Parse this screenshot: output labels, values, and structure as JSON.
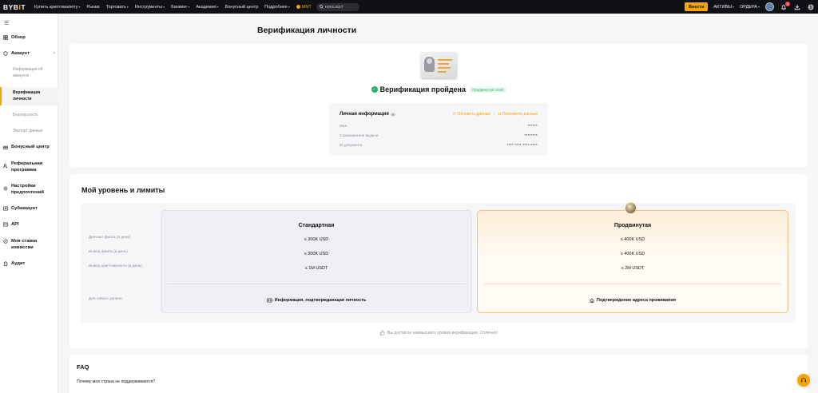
{
  "topbar": {
    "logo_main": "BYB",
    "logo_accent": "I",
    "logo_end": "T",
    "nav": [
      {
        "label": "Купить криптовалюту",
        "has_menu": true
      },
      {
        "label": "Рынки",
        "has_menu": false
      },
      {
        "label": "Торговать",
        "has_menu": true
      },
      {
        "label": "Инструменты",
        "has_menu": true
      },
      {
        "label": "Банкинг",
        "has_menu": true
      },
      {
        "label": "Академия",
        "has_menu": true
      },
      {
        "label": "Бонусный центр",
        "has_menu": false
      },
      {
        "label": "Подробнее",
        "has_menu": true
      }
    ],
    "mnt_label": "MNT",
    "search_placeholder": "HSK/USDT",
    "deposit_label": "Внести",
    "assets_label": "АКТИВЫ",
    "orders_label": "ОРДЕРА",
    "notification_count": "3",
    "accent_color": "#f7a600"
  },
  "sidebar": {
    "overview": "Обзор",
    "account": "Аккаунт",
    "account_subitems": [
      "Информация об аккаунте",
      "Верификация личности",
      "Безопасность",
      "Экспорт данных"
    ],
    "bonus_center": "Бонусный центр",
    "referral": "Реферальная программа",
    "preferences": "Настройки предпочтений",
    "subaccount": "Субаккаунт",
    "api": "API",
    "fee_rate": "Моя ставка комиссии",
    "audit": "Аудит"
  },
  "main": {
    "page_title": "Верификация личности",
    "verified_text": "Верификация пройдена",
    "level_tag": "Продвинутая Level",
    "personal_info": {
      "title": "Личная информация",
      "update_label": "Обновить данные",
      "transfer_label": "Перенести данные",
      "rows": [
        {
          "label": "Имя",
          "value": "******"
        },
        {
          "label": "Страна/регион выдачи",
          "value": "********"
        },
        {
          "label": "ID документа",
          "value": "**** **** ****-****"
        }
      ]
    },
    "limits": {
      "title": "Мой уровень и лимиты",
      "row_labels": [
        "Депозит фиата (в день)",
        "Вывод фиата (в день)",
        "Вывод криптовалюты (в день)",
        "Для нового уровня"
      ],
      "standard": {
        "name": "Стандартная",
        "values": [
          "≤ 300K USD",
          "≤ 300K USD",
          "≤ 1M USDT"
        ],
        "requirement": "Информация, подтверждающая личность"
      },
      "advanced": {
        "name": "Продвинутая",
        "values": [
          "≤ 400K USD",
          "≤ 400K USD",
          "≤ 2M USDT"
        ],
        "requirement": "Подтверждение адреса проживания"
      },
      "reached_text": "Вы достигли наивысшего уровня верификации. Отлично!"
    },
    "faq": {
      "title": "FAQ",
      "question": "Почему моя страна не поддерживается?"
    }
  }
}
